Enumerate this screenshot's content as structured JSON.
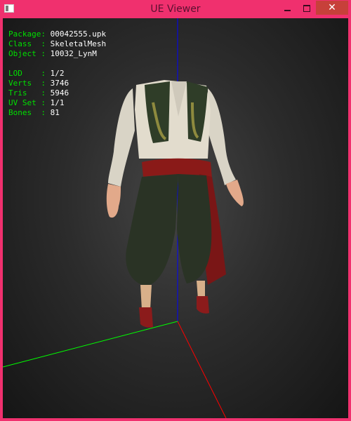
{
  "window": {
    "title": "UE Viewer",
    "controls": {
      "minimize": "–",
      "maximize": "□",
      "close": "✕"
    }
  },
  "info": {
    "package_label": "Package: ",
    "package_value": "00042555.upk",
    "class_label": "Class  : ",
    "class_value": "SkeletalMesh",
    "object_label": "Object : ",
    "object_value": "10032_LynM",
    "lod_label": "LOD    : ",
    "lod_value": "1/2",
    "verts_label": "Verts  : ",
    "verts_value": "3746",
    "tris_label": "Tris   : ",
    "tris_value": "5946",
    "uvset_label": "UV Set : ",
    "uvset_value": "1/1",
    "bones_label": "Bones  : ",
    "bones_value": "81"
  },
  "colors": {
    "frame": "#f0306e",
    "label_text": "#00e000",
    "value_text": "#ffffff",
    "axis_x": "#ff0000",
    "axis_y": "#00ff00",
    "axis_z": "#0000ff",
    "close_button": "#c7403a"
  },
  "scene": {
    "model": "headless male outfit: white shirt, green embroidered vest, red sash, dark green pants, red shoes",
    "axes": [
      "x-axis-red",
      "y-axis-green",
      "z-axis-blue"
    ]
  }
}
